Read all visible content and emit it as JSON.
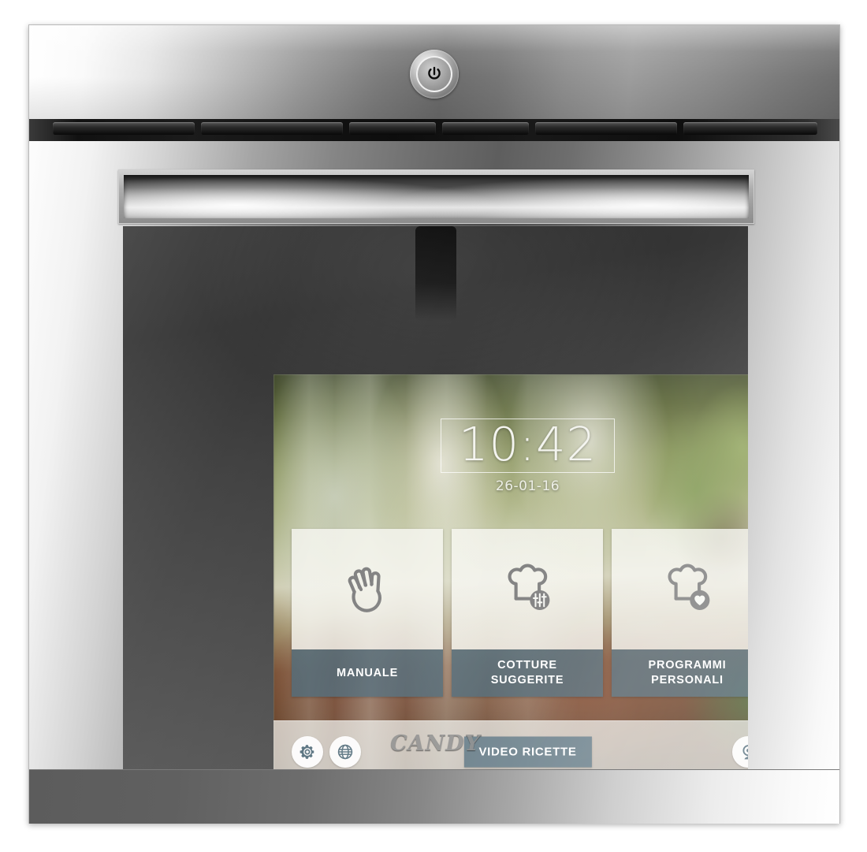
{
  "appliance": {
    "brand": "CANDY",
    "power_button_icon": "power-icon"
  },
  "screen": {
    "statusbar": {
      "wifi_icon": "wifi-icon"
    },
    "clock": {
      "time": "10:42",
      "date": "26-01-16"
    },
    "tiles": [
      {
        "label": "MANUALE",
        "icon": "hand-icon"
      },
      {
        "label": "COTTURE\nSUGGERITE",
        "icon": "chef-hat-sliders-icon"
      },
      {
        "label": "PROGRAMMI\nPERSONALI",
        "icon": "chef-hat-heart-icon"
      }
    ],
    "toolbar": {
      "settings_icon": "gear-icon",
      "network_icon": "globe-icon",
      "video_recipes_label": "VIDEO RICETTE",
      "webcam_icon": "webcam-icon"
    }
  },
  "colors": {
    "tile_label_bar": "#4a6574",
    "tile_face": "#f7f8f3",
    "accent_button": "#5d7684",
    "screen_text": "#ffffff"
  }
}
